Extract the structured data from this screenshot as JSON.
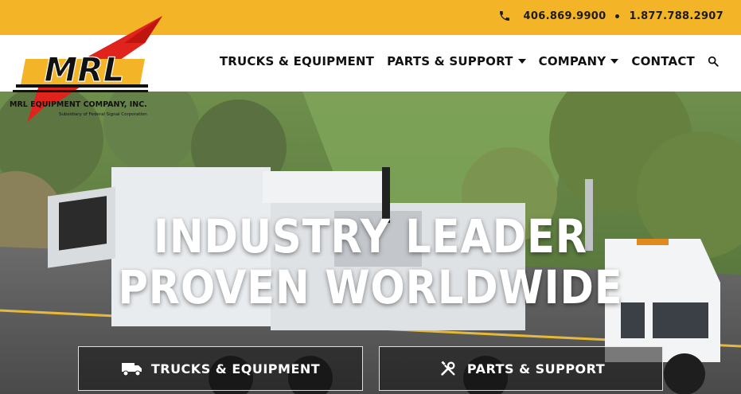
{
  "topbar": {
    "phone_1": "406.869.9900",
    "phone_2": "1.877.788.2907",
    "icon": "phone-icon",
    "color": "#f4b428"
  },
  "logo": {
    "mark": "MRL",
    "company": "MRL EQUIPMENT COMPANY, INC.",
    "subsidiary": "Subsidiary of Federal Signal Corporation"
  },
  "nav": {
    "items": [
      {
        "label": "TRUCKS & EQUIPMENT",
        "dropdown": false
      },
      {
        "label": "PARTS & SUPPORT",
        "dropdown": true
      },
      {
        "label": "COMPANY",
        "dropdown": true
      },
      {
        "label": "CONTACT",
        "dropdown": false
      }
    ],
    "search_icon": "search-icon"
  },
  "hero": {
    "headline_line1": "INDUSTRY LEADER",
    "headline_line2": "PROVEN WORLDWIDE",
    "buttons": [
      {
        "label": "TRUCKS & EQUIPMENT",
        "icon": "truck-icon"
      },
      {
        "label": "PARTS & SUPPORT",
        "icon": "wrench-screwdriver-icon"
      }
    ]
  },
  "colors": {
    "brand_yellow": "#f4b428",
    "brand_red": "#e0231c",
    "text_dark": "#111111"
  }
}
